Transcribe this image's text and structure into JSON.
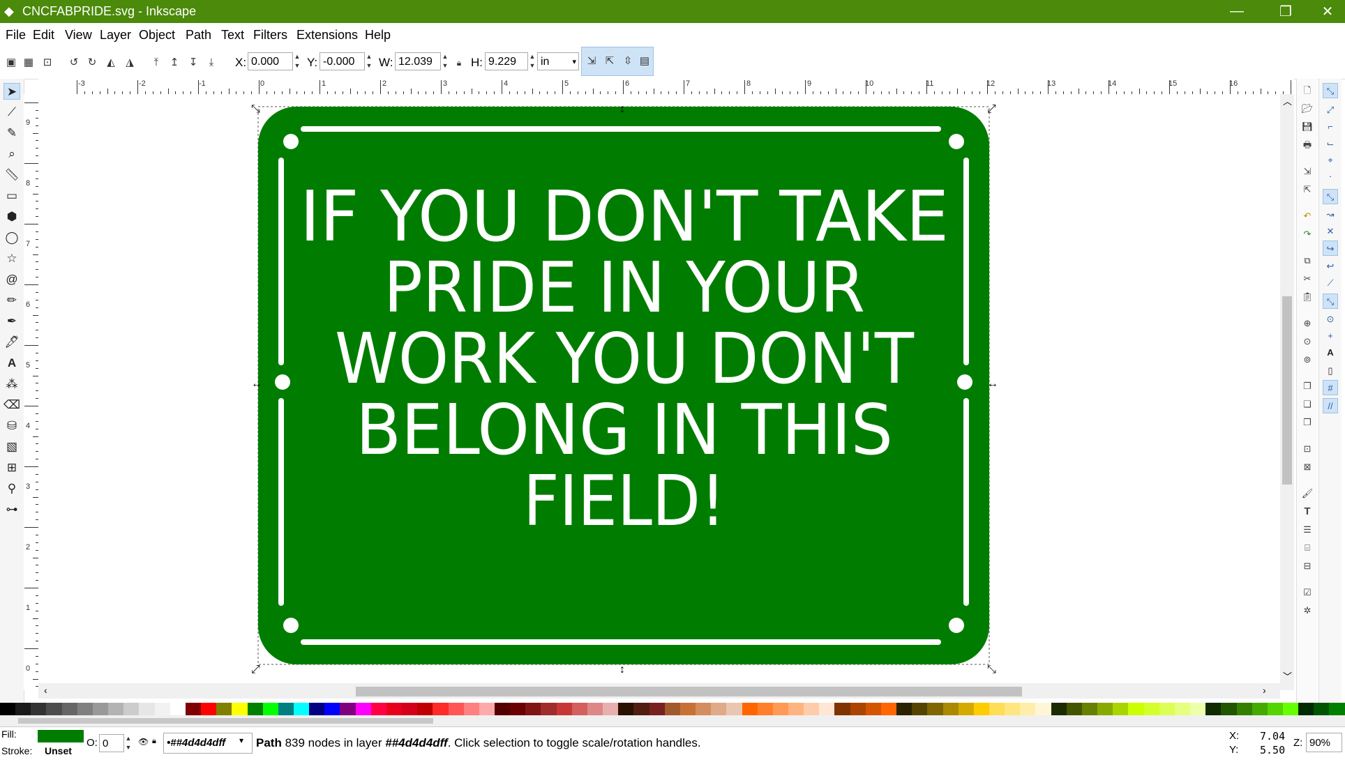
{
  "window": {
    "title": "CNCFABPRIDE.svg - Inkscape",
    "controls": {
      "minimize": "—",
      "maximize": "❐",
      "close": "✕"
    }
  },
  "menu": [
    "File",
    "Edit",
    "View",
    "Layer",
    "Object",
    "Path",
    "Text",
    "Filters",
    "Extensions",
    "Help"
  ],
  "toolbar": {
    "x_label": "X:",
    "x_value": "0.000",
    "y_label": "Y:",
    "y_value": "-0.000",
    "w_label": "W:",
    "w_value": "12.039",
    "h_label": "H:",
    "h_value": "9.229",
    "unit": "in"
  },
  "ruler_top": [
    "-3",
    "-2",
    "-1",
    "0",
    "1",
    "2",
    "3",
    "4",
    "5",
    "6",
    "7",
    "8",
    "9",
    "10",
    "11",
    "12",
    "13",
    "14",
    "15",
    "16"
  ],
  "ruler_left": [
    "9",
    "8",
    "7",
    "6",
    "5",
    "4",
    "3",
    "2",
    "1",
    "0"
  ],
  "canvas": {
    "sign_text_lines": [
      "IF YOU DON'T TAKE",
      "PRIDE IN YOUR",
      "WORK YOU DON'T",
      "BELONG IN THIS",
      "FIELD!"
    ],
    "sign_color": "#007d00",
    "text_color": "#ffffff"
  },
  "palette": [
    "#000000",
    "#1a1a1a",
    "#333333",
    "#4d4d4d",
    "#666666",
    "#808080",
    "#999999",
    "#b3b3b3",
    "#cccccc",
    "#e6e6e6",
    "#f2f2f2",
    "#ffffff",
    "#800000",
    "#ff0000",
    "#808000",
    "#ffff00",
    "#008000",
    "#00ff00",
    "#008080",
    "#00ffff",
    "#000080",
    "#0000ff",
    "#800080",
    "#ff00ff",
    "#ff0044",
    "#e8001b",
    "#d40019",
    "#c00000",
    "#ff2a2a",
    "#ff5555",
    "#ff8080",
    "#ffaaaa",
    "#550000",
    "#6b0000",
    "#801515",
    "#a02c2c",
    "#c83737",
    "#d35f5f",
    "#de8787",
    "#e9afaf",
    "#2b1100",
    "#501f0f",
    "#782121",
    "#a05a2c",
    "#c87137",
    "#d38d5f",
    "#deaa87",
    "#e9c6af",
    "#ff6600",
    "#ff7f2a",
    "#ff9955",
    "#ffb380",
    "#ffccaa",
    "#ffe6d5",
    "#803300",
    "#aa4400",
    "#d45500",
    "#ff6600",
    "#2b2200",
    "#554400",
    "#806600",
    "#aa8800",
    "#d4aa00",
    "#ffcc00",
    "#ffdd55",
    "#ffe680",
    "#ffeeaa",
    "#fff6d5",
    "#1c2b00",
    "#445500",
    "#668000",
    "#88aa00",
    "#aad400",
    "#ccff00",
    "#d4ff2a",
    "#ddff55",
    "#e5ff80",
    "#eeffaa",
    "#112b00",
    "#225500",
    "#338000",
    "#44aa00",
    "#55d400",
    "#66ff00",
    "#002b00",
    "#005500",
    "#008000"
  ],
  "status": {
    "fill_label": "Fill:",
    "stroke_label": "Stroke:",
    "stroke_value": "Unset",
    "fill_color": "#007d00",
    "opacity_label": "O:",
    "opacity_value": "0",
    "layer_name": "•##4d4d4dff",
    "message_strong": "Path",
    "message_1": " 839 nodes in layer ",
    "message_layer": "##4d4d4dff",
    "message_2": ". Click selection to toggle scale/rotation handles.",
    "x_coord_label": "X:",
    "x_coord": "7.04",
    "y_coord_label": "Y:",
    "y_coord": "5.50",
    "zoom_label": "Z:",
    "zoom": "90%"
  }
}
